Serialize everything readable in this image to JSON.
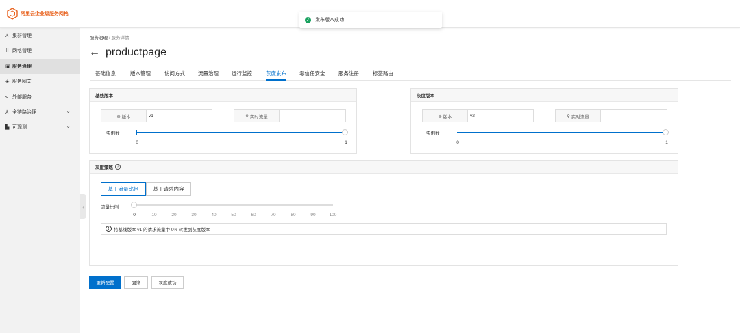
{
  "brand": {
    "name": "阿里云企业级服务网格",
    "logo_icon": "hexagon-logo-icon",
    "color": "#e8621e"
  },
  "toast": {
    "message": "发布版本成功",
    "icon": "check-circle-icon"
  },
  "sidebar": {
    "items": [
      {
        "icon": "cluster-icon",
        "glyph": "⅄",
        "label": "集群管理",
        "active": false
      },
      {
        "icon": "grid-icon",
        "glyph": "⠿",
        "label": "网格管理",
        "active": false
      },
      {
        "icon": "service-icon",
        "glyph": "▣",
        "label": "服务治理",
        "active": true
      },
      {
        "icon": "gateway-icon",
        "glyph": "◈",
        "label": "服务网关",
        "active": false
      },
      {
        "icon": "share-icon",
        "glyph": "<",
        "label": "外部服务",
        "active": false
      },
      {
        "icon": "trace-icon",
        "glyph": "⅄",
        "label": "全链路治理",
        "active": false,
        "expandable": true
      },
      {
        "icon": "chart-icon",
        "glyph": "▙",
        "label": "可观测",
        "active": false,
        "expandable": true
      }
    ]
  },
  "breadcrumb": {
    "root": "服务治理",
    "sep": "/",
    "current": "服务详情"
  },
  "page_title": "productpage",
  "tabs": [
    {
      "label": "基础信息"
    },
    {
      "label": "版本管理"
    },
    {
      "label": "访问方式"
    },
    {
      "label": "流量治理"
    },
    {
      "label": "运行监控"
    },
    {
      "label": "灰度发布",
      "active": true
    },
    {
      "label": "零信任安全"
    },
    {
      "label": "服务注册"
    },
    {
      "label": "标签路由"
    }
  ],
  "baseline": {
    "header": "基线版本",
    "version_label": "版本",
    "version_value": "v1",
    "traffic_label": "实时流量",
    "traffic_value": "",
    "instances_label": "实例数",
    "min": "0",
    "max": "1",
    "instance_fraction": 1.0
  },
  "canary": {
    "header": "灰度版本",
    "version_label": "版本",
    "version_value": "v2",
    "traffic_label": "实时流量",
    "traffic_value": "",
    "instances_label": "实例数",
    "min": "0",
    "max": "1",
    "instance_fraction": 1.0
  },
  "strategy": {
    "header": "灰度策略",
    "options": [
      {
        "label": "基于流量比例",
        "active": true
      },
      {
        "label": "基于请求内容",
        "active": false
      }
    ],
    "ratio_label": "流量比例",
    "ratio_value": 0,
    "ticks": [
      "0",
      "10",
      "20",
      "30",
      "40",
      "50",
      "60",
      "70",
      "80",
      "90",
      "100"
    ],
    "notice": "将基线版本 v1 的请求流量中 0% 转发到灰度版本"
  },
  "actions": {
    "update": "更新配置",
    "rollback": "回滚",
    "success": "灰度成功"
  },
  "colors": {
    "primary": "#0070cc",
    "success": "#1aa260"
  }
}
